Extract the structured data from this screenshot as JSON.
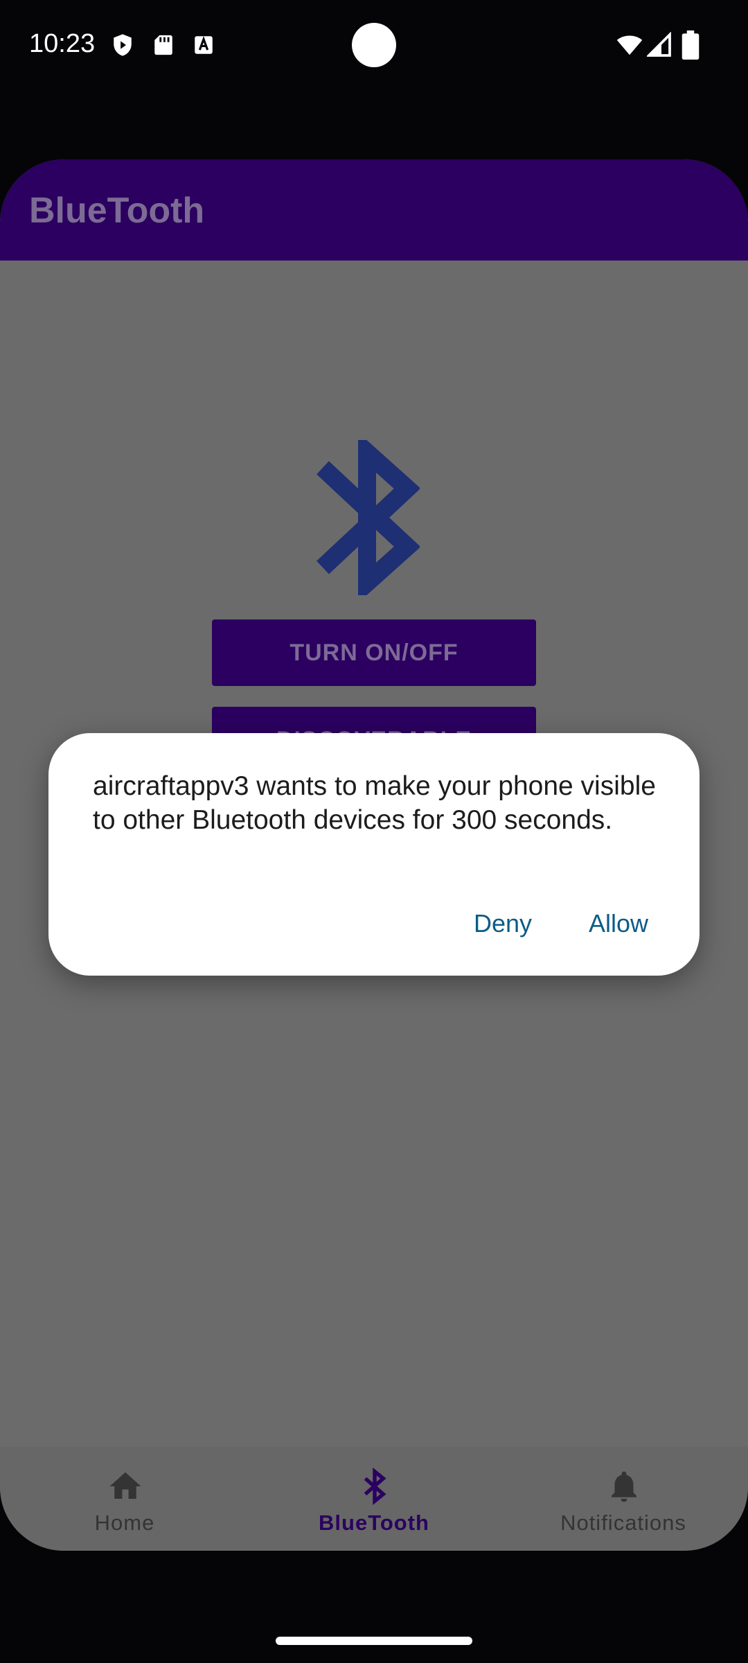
{
  "status_bar": {
    "time": "10:23",
    "icons": [
      "play-protect-icon",
      "sd-card-icon",
      "text-a-icon",
      "wifi-icon",
      "signal-icon",
      "battery-icon"
    ]
  },
  "app_bar": {
    "title": "BlueTooth"
  },
  "main": {
    "icon": "bluetooth-icon",
    "buttons": {
      "turn_on_off": "TURN ON/OFF",
      "discoverable": "DISCOVERABLE"
    }
  },
  "dialog": {
    "message": "aircraftappv3 wants to make your phone visible to other Bluetooth devices for 300 seconds.",
    "deny": "Deny",
    "allow": "Allow"
  },
  "bottom_nav": {
    "items": [
      {
        "label": "Home",
        "icon": "home-icon",
        "active": false
      },
      {
        "label": "BlueTooth",
        "icon": "bluetooth-icon",
        "active": true
      },
      {
        "label": "Notifications",
        "icon": "bell-icon",
        "active": false
      }
    ]
  },
  "colors": {
    "primary": "#2b0060",
    "scrim_background": "#6b6b6b",
    "dialog_button": "#0b5c86",
    "bluetooth_logo": "#1e2f73"
  }
}
